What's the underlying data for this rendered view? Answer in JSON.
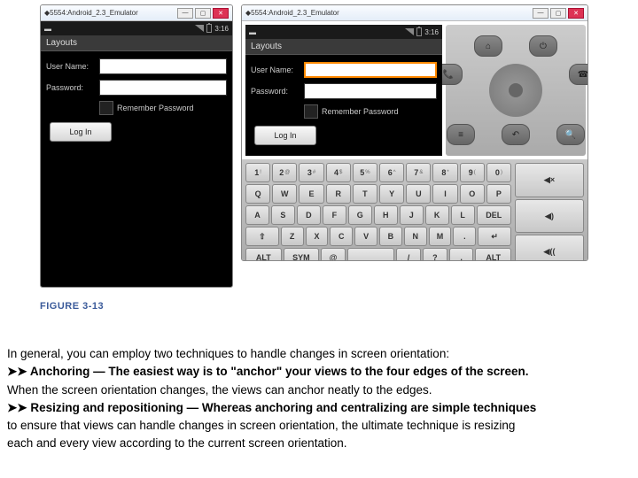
{
  "emulator": {
    "window_title": "5554:Android_2.3_Emulator",
    "clock": "3:16",
    "app_title": "Layouts",
    "username_label": "User Name:",
    "password_label": "Password:",
    "remember_label": "Remember Password",
    "login_label": "Log In"
  },
  "keyboard": {
    "row1": [
      "1",
      "2",
      "3",
      "4",
      "5",
      "6",
      "7",
      "8",
      "9",
      "0"
    ],
    "row1_shift": [
      "!",
      "@",
      "#",
      "$",
      "%",
      "^",
      "&",
      "*",
      "(",
      ")"
    ],
    "row2": [
      "Q",
      "W",
      "E",
      "R",
      "T",
      "Y",
      "U",
      "I",
      "O",
      "P"
    ],
    "row3": [
      "A",
      "S",
      "D",
      "F",
      "G",
      "H",
      "J",
      "K",
      "L",
      "DEL"
    ],
    "row4_lead": "⇧",
    "row4": [
      "Z",
      "X",
      "C",
      "V",
      "B",
      "N",
      "M",
      ".",
      "↵"
    ],
    "row5": [
      "ALT",
      "SYM",
      "@",
      " ",
      "/",
      "?",
      ",",
      "ALT"
    ],
    "side": [
      "◀×",
      "◀)",
      "◀(("
    ]
  },
  "hw": {
    "call": "📞",
    "home": "⌂",
    "menu": "≡",
    "back": "↶",
    "search": "🔍",
    "end": "☎"
  },
  "figure_label": "FIGURE 3-13",
  "text": {
    "p1": "In general, you can employ two techniques to handle changes in screen orientation:",
    "b1_lead": "➤➤ Anchoring — The easiest way is to \"anchor\" your views to the four edges of the screen.",
    "p2": "When the screen orientation changes, the views can anchor neatly to the edges.",
    "b2_lead": "➤➤ Resizing and repositioning — Whereas anchoring and centralizing are simple techniques",
    "p3": "to ensure that views can handle changes in screen orientation, the ultimate technique is resizing",
    "p4": "each and every view according to the current screen orientation."
  }
}
